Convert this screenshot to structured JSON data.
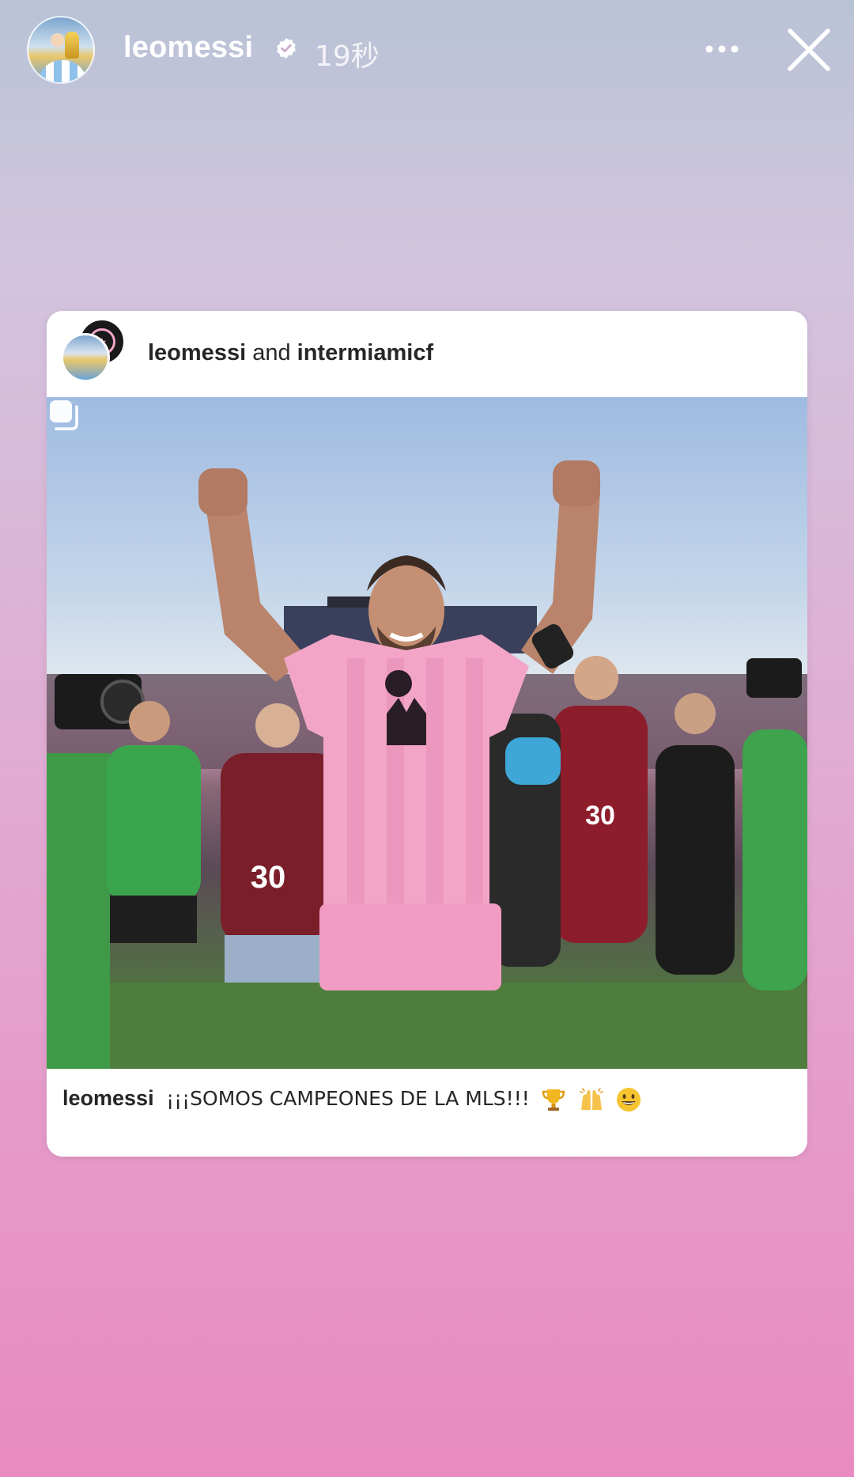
{
  "story": {
    "username": "leomessi",
    "time_ago": "19秒",
    "verified": true
  },
  "post": {
    "coauthor_1": "leomessi",
    "coauthor_joiner": "and",
    "coauthor_2": "intermiamicf",
    "caption_user": "leomessi",
    "caption_text": "¡¡¡SOMOS CAMPEONES DE LA MLS!!!",
    "caption_emojis": [
      "trophy",
      "raising-hands",
      "smiley"
    ],
    "photo_number_labels": [
      "30",
      "30"
    ]
  },
  "icons": {
    "more": "more-horizontal-icon",
    "close": "close-icon",
    "verified": "verified-badge-icon",
    "multi": "multi-image-icon"
  },
  "colors": {
    "background_top": "#b9c3d6",
    "background_bottom": "#e98ac0",
    "jersey_pink": "#f3a5c8",
    "text_dark": "#262626"
  }
}
